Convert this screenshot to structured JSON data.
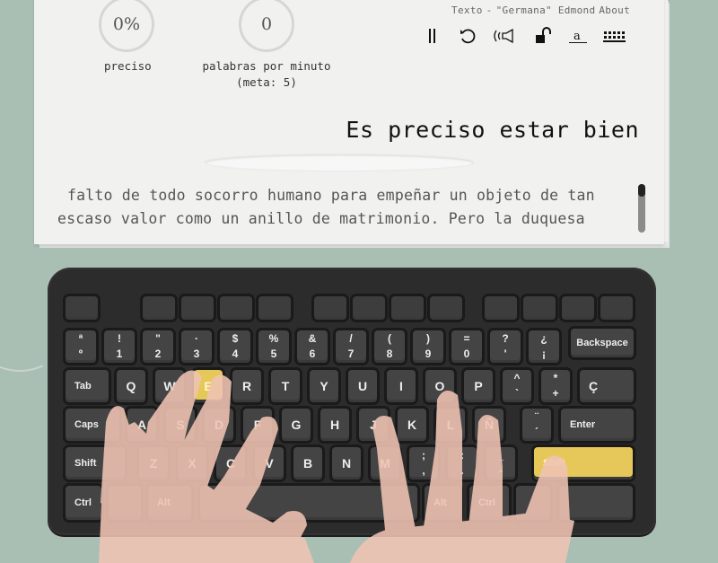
{
  "stats": {
    "accuracy": {
      "value": "0%",
      "label": "preciso"
    },
    "wpm": {
      "value": "0",
      "label": "palabras por minuto",
      "goal": "(meta: 5)"
    }
  },
  "nav": {
    "text_label": "Texto",
    "separator": "-",
    "title": "\"Germana\" Edmond",
    "about": "About"
  },
  "toolbar": [
    {
      "name": "pause-icon",
      "glyph": "‖"
    },
    {
      "name": "restart-icon",
      "glyph": "↺"
    },
    {
      "name": "sound-icon",
      "glyph": "sound"
    },
    {
      "name": "unlock-icon",
      "glyph": "lock"
    },
    {
      "name": "font-icon",
      "glyph": "a"
    },
    {
      "name": "keyboard-icon",
      "glyph": "keyboard"
    }
  ],
  "current_phrase": "Es preciso estar bien",
  "input": {
    "value": "",
    "placeholder": ""
  },
  "text_lines": [
    "falto de todo socorro humano para empeñar un objeto de tan",
    "escaso valor como un anillo de matrimonio. Pero la duquesa"
  ],
  "scroll": {
    "position": 0.0
  },
  "highlight_color": "#e6c85a",
  "keyboard": {
    "row1": [
      {
        "top": "ª",
        "bottom": "º"
      },
      {
        "top": "!",
        "bottom": "1"
      },
      {
        "top": "\"",
        "bottom": "2"
      },
      {
        "top": "·",
        "bottom": "3"
      },
      {
        "top": "$",
        "bottom": "4"
      },
      {
        "top": "%",
        "bottom": "5"
      },
      {
        "top": "&",
        "bottom": "6"
      },
      {
        "top": "/",
        "bottom": "7"
      },
      {
        "top": "(",
        "bottom": "8"
      },
      {
        "top": ")",
        "bottom": "9"
      },
      {
        "top": "=",
        "bottom": "0"
      },
      {
        "top": "?",
        "bottom": "'"
      },
      {
        "top": "¿",
        "bottom": "¡"
      }
    ],
    "backspace": "Backspace",
    "tab": "Tab",
    "row2": [
      "Q",
      "W",
      "E",
      "R",
      "T",
      "Y",
      "U",
      "I",
      "O",
      "P"
    ],
    "row2_extra": [
      {
        "top": "^",
        "bottom": "`"
      },
      {
        "top": "*",
        "bottom": "+"
      }
    ],
    "cedilla": "Ç",
    "caps": "Caps",
    "row3": [
      "A",
      "S",
      "D",
      "F",
      "G",
      "H",
      "J",
      "K",
      "L",
      "Ñ"
    ],
    "row3_extra": {
      "top": "¨",
      "bottom": "´"
    },
    "enter": "Enter",
    "shift_left": "Shift",
    "row4": [
      "Z",
      "X",
      "C",
      "V",
      "B",
      "N",
      "M"
    ],
    "row4_extra": [
      {
        "top": ";",
        "bottom": ","
      },
      {
        "top": ":",
        "bottom": "."
      },
      {
        "top": "_",
        "bottom": "-"
      }
    ],
    "shift_right": "Shift",
    "ctrl_left": "Ctrl",
    "alt_left": "Alt",
    "alt_right": "Alt",
    "ctrl_right": "Ctrl",
    "highlighted_keys": [
      "E",
      "Shift-right"
    ]
  }
}
